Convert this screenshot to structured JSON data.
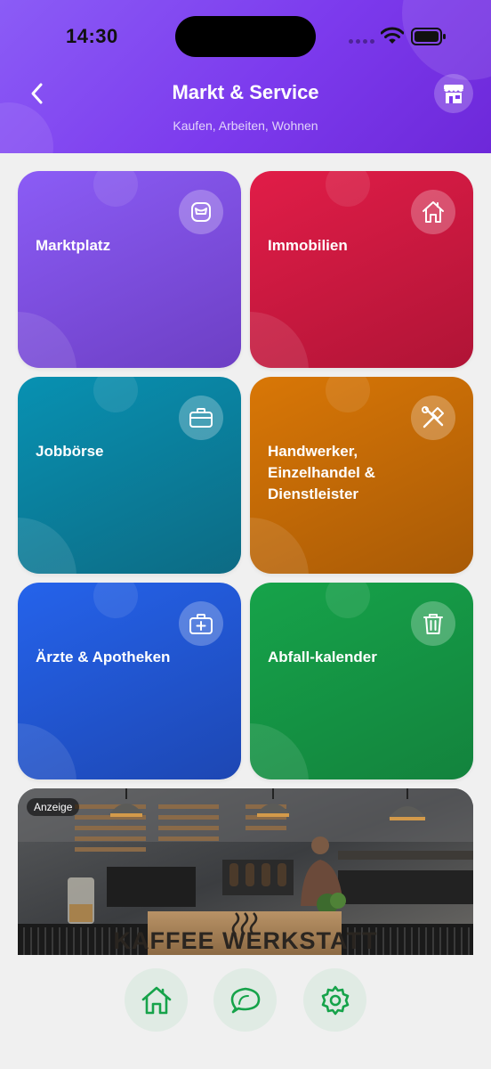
{
  "status_bar": {
    "time": "14:30"
  },
  "header": {
    "title": "Markt & Service",
    "subtitle": "Kaufen, Arbeiten, Wohnen",
    "back_icon": "chevron-left-icon",
    "action_icon": "store-icon"
  },
  "tiles": [
    {
      "label": "Marktplatz",
      "icon": "bag-icon",
      "color": "#8b5cf6"
    },
    {
      "label": "Immobilien",
      "icon": "house-icon",
      "color": "#e11d48"
    },
    {
      "label": "Jobbörse",
      "icon": "briefcase-icon",
      "color": "#0891b2"
    },
    {
      "label": "Handwerker, Einzelhandel & Dienstleister",
      "icon": "tools-icon",
      "color": "#d97706"
    },
    {
      "label": "Ärzte & Apotheken",
      "icon": "medical-kit-icon",
      "color": "#2563eb"
    },
    {
      "label": "Abfall-kalender",
      "icon": "trash-icon",
      "color": "#16a34a"
    }
  ],
  "ad": {
    "badge": "Anzeige",
    "menu_left": [
      "ESPRESSO",
      "CAPPUCCINO",
      "FLAT WHITE",
      "LATTE MAC.",
      "CAFE AU LAIT"
    ],
    "menu_mid": [
      "FILTER",
      "TEE",
      "KAKAO",
      "CHAI LATTE"
    ],
    "menu_right": [
      "LIMONADE",
      "ELDERFLOWER",
      "SPRITZ"
    ],
    "counter_sign": "KAFFEE WERKSTATT"
  },
  "bottom_nav": {
    "items": [
      {
        "icon": "home-icon",
        "color": "#16a34a"
      },
      {
        "icon": "chat-icon",
        "color": "#16a34a"
      },
      {
        "icon": "settings-icon",
        "color": "#16a34a"
      }
    ]
  }
}
